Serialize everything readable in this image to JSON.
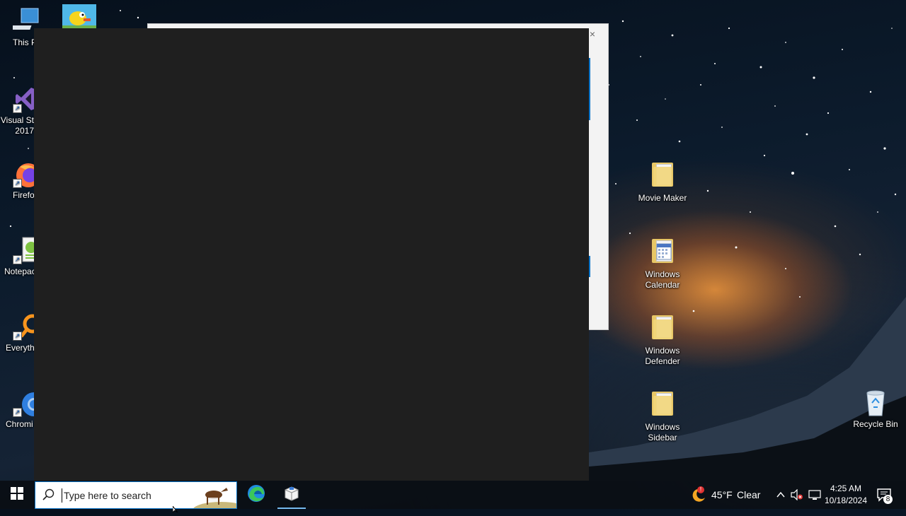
{
  "desktop": {
    "left_icons": [
      {
        "label": "This P"
      },
      {
        "label": "Visual St 2017"
      },
      {
        "label": "Firefo"
      },
      {
        "label": "Notepac"
      },
      {
        "label": "Everyth"
      },
      {
        "label": "Chromi"
      }
    ],
    "right_icons": [
      {
        "label": "Movie Maker"
      },
      {
        "label": "Windows Calendar"
      },
      {
        "label": "Windows Defender"
      },
      {
        "label": "Windows Sidebar"
      }
    ],
    "recycle_bin": {
      "label": "Recycle Bin"
    }
  },
  "window": {
    "close_glyph": "×"
  },
  "taskbar": {
    "search": {
      "placeholder": "Type here to search"
    },
    "weather": {
      "temperature": "45°F",
      "condition": "Clear",
      "alert_badge": "!"
    },
    "clock": {
      "time": "4:25 AM",
      "date": "10/18/2024"
    },
    "notifications": {
      "count": "8"
    },
    "icons": [
      "windows-logo-icon",
      "search-icon",
      "edge-icon",
      "package-icon",
      "chevron-up-icon",
      "volume-muted-icon",
      "network-icon",
      "notification-icon"
    ]
  },
  "colors": {
    "accent": "#0a74c9",
    "dark_panel": "#1f1f1f"
  }
}
